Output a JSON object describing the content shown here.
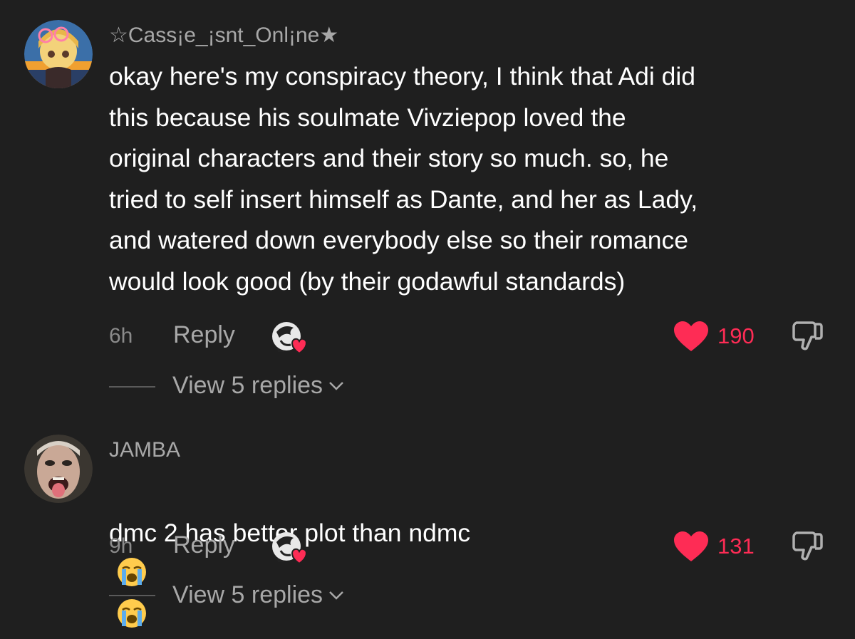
{
  "comments": [
    {
      "username": "☆Cass¡e_¡snt_Onl¡ne★",
      "text": "okay here's my conspiracy theory, I think that Adi did\nthis because his soulmate Vivziepop loved the\noriginal characters and their story so much. so, he\ntried to self insert himself as Dante, and her as Lady,\nand watered down everybody else so their romance\nwould look good (by their godawful standards)",
      "time": "6h",
      "reply_label": "Reply",
      "likes": "190",
      "view_replies": "View 5 replies"
    },
    {
      "username": "JAMBA",
      "text": "dmc 2 has better plot than ndmc",
      "emoji": [
        "loudly-crying-face",
        "loudly-crying-face"
      ],
      "time": "9h",
      "reply_label": "Reply",
      "likes": "131",
      "view_replies": "View 5 replies"
    }
  ],
  "colors": {
    "background": "#1f1f1f",
    "like_red": "#fe2c55",
    "muted_text": "#a8a8a8"
  }
}
